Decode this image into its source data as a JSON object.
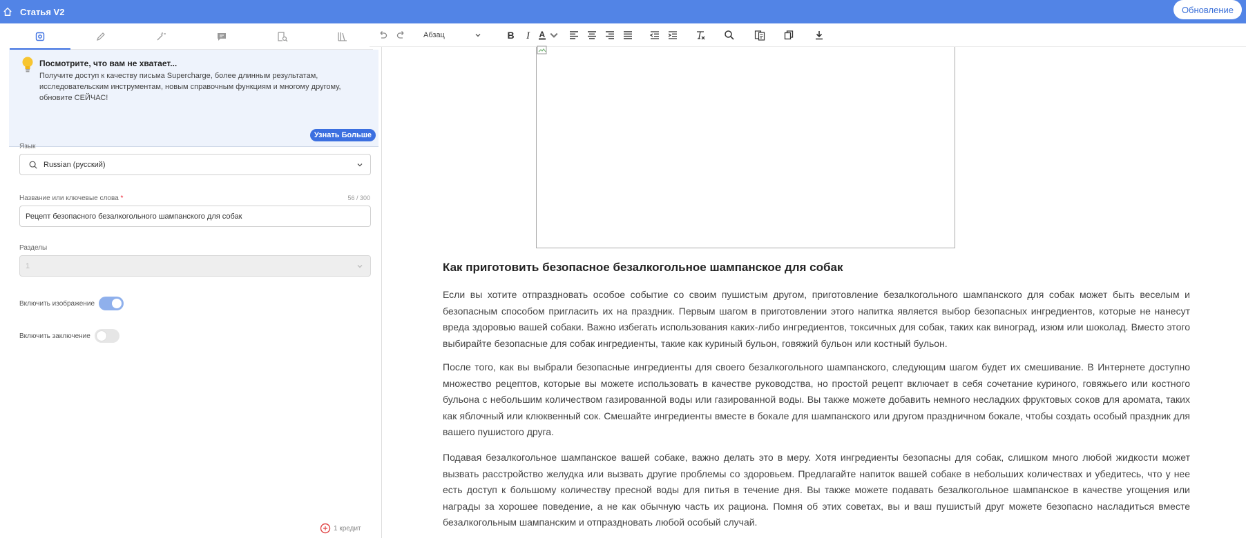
{
  "header": {
    "title": "Статья V2",
    "update_label": "Обновление"
  },
  "sidebar": {
    "tabs": [
      {
        "icon": "settings-icon",
        "active": true
      },
      {
        "icon": "pencil-icon",
        "active": false
      },
      {
        "icon": "magic-wand-icon",
        "active": false
      },
      {
        "icon": "comment-icon",
        "active": false
      },
      {
        "icon": "document-search-icon",
        "active": false
      },
      {
        "icon": "library-icon",
        "active": false
      }
    ],
    "promo": {
      "title": "Посмотрите, что вам не хватает...",
      "text": "Получите доступ к качеству письма Supercharge, более длинным результатам, исследовательским инструментам, новым справочным функциям и многому другому, обновите СЕЙЧАС!",
      "button": "Узнать Больше"
    },
    "language": {
      "label": "Язык",
      "value": "Russian (русский)"
    },
    "title_field": {
      "label": "Название или ключевые слова",
      "required_mark": "*",
      "counter": "56 / 300",
      "value": "Рецепт безопасного безалкогольного шампанского для собак"
    },
    "sections": {
      "label": "Разделы",
      "value": "1"
    },
    "include_image": {
      "label": "Включить изображение",
      "on": true
    },
    "include_conclusion": {
      "label": "Включить заключение",
      "on": false
    },
    "credit": "1 кредит"
  },
  "toolbar": {
    "format_value": "Абзац",
    "accent": "#3b6fe0"
  },
  "article": {
    "heading": "Как приготовить безопасное безалкогольное шампанское для собак",
    "paragraphs": [
      "Если вы хотите отпраздновать особое событие со своим пушистым другом, приготовление безалкогольного шампанского для собак может быть веселым и безопасным способом пригласить их на праздник. Первым шагом в приготовлении этого напитка является выбор безопасных ингредиентов, которые не нанесут вреда здоровью вашей собаки. Важно избегать использования каких-либо ингредиентов, токсичных для собак, таких как виноград, изюм или шоколад. Вместо этого выбирайте безопасные для собак ингредиенты, такие как куриный бульон, говяжий бульон или костный бульон.",
      "После того, как вы выбрали безопасные ингредиенты для своего безалкогольного шампанского, следующим шагом будет их смешивание. В Интернете доступно множество рецептов, которые вы можете использовать в качестве руководства, но простой рецепт включает в себя сочетание куриного, говяжьего или костного бульона с небольшим количеством газированной воды или газированной воды. Вы также можете добавить немного несладких фруктовых соков для аромата, таких как яблочный или клюквенный сок. Смешайте ингредиенты вместе в бокале для шампанского или другом праздничном бокале, чтобы создать особый праздник для вашего пушистого друга.",
      "Подавая безалкогольное шампанское вашей собаке, важно делать это в меру. Хотя ингредиенты безопасны для собак, слишком много любой жидкости может вызвать расстройство желудка или вызвать другие проблемы со здоровьем. Предлагайте напиток вашей собаке в небольших количествах и убедитесь, что у нее есть доступ к большому количеству пресной воды для питья в течение дня. Вы также можете подавать безалкогольное шампанское в качестве угощения или награды за хорошее поведение, а не как обычную часть их рациона. Помня об этих советах, вы и ваш пушистый друг можете безопасно насладиться вместе безалкогольным шампанским и отпраздновать любой особый случай."
    ]
  }
}
